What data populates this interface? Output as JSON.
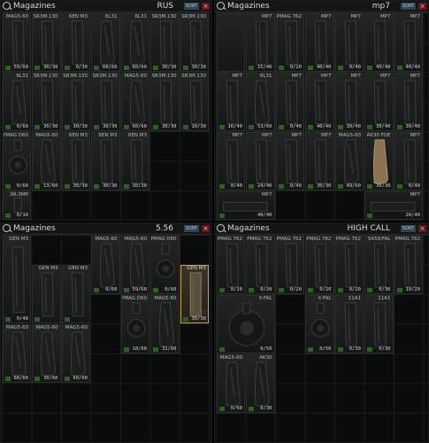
{
  "colors": {
    "accent": "#2e4455",
    "close": "#6a1616",
    "found": "#2f5e28",
    "highlight": "#c9a24a",
    "tan": "#8a7252"
  },
  "panels": [
    {
      "title": "Magazines",
      "filter": "RUS",
      "sort": "SORT",
      "icon_search": "search-icon",
      "close": "×",
      "items": [
        {
          "name": "MAG5-60",
          "count": "59/60"
        },
        {
          "name": "SR3M.130",
          "count": "30/30"
        },
        {
          "name": "6EN M3",
          "count": "0/30"
        },
        {
          "name": "6L31",
          "count": "60/60"
        },
        {
          "name": "6L31",
          "count": "60/60"
        },
        {
          "name": "SR3M.130",
          "count": "30/30"
        },
        {
          "name": "SR3M.130",
          "count": "30/30"
        },
        {
          "name": "6L31",
          "count": "0/60"
        },
        {
          "name": "SR3M.130",
          "count": "30/30"
        },
        {
          "name": "SR3M.130",
          "count": "30/30"
        },
        {
          "name": "SR3M.130",
          "count": "30/30"
        },
        {
          "name": "MAG5-60",
          "count": "60/60"
        },
        {
          "name": "SR3M.130",
          "count": "30/30"
        },
        {
          "name": "SR3M.130",
          "count": "10/30"
        },
        {
          "name": "PMAG D60",
          "count": "0/60"
        },
        {
          "name": "MAG5-60",
          "count": "13/60"
        },
        {
          "name": "6EN M3",
          "count": "30/30"
        },
        {
          "name": "6EN M3",
          "count": "30/30"
        },
        {
          "name": "6EN M3",
          "count": "30/30"
        },
        {
          "name": "SR-3MP",
          "count": "0/10"
        }
      ]
    },
    {
      "title": "Magazines",
      "filter": "mp7",
      "sort": "SORT",
      "icon_search": "search-icon",
      "close": "×",
      "items": [
        {
          "name": "",
          "count": ""
        },
        {
          "name": "MP7",
          "count": "15/40"
        },
        {
          "name": "PMAG 762",
          "count": "0/20"
        },
        {
          "name": "MP7",
          "count": "40/40"
        },
        {
          "name": "MP7",
          "count": "0/40"
        },
        {
          "name": "MP7",
          "count": "40/40"
        },
        {
          "name": "MP7",
          "count": "40/40"
        },
        {
          "name": "MP7",
          "count": "16/40"
        },
        {
          "name": "6L31",
          "count": "53/60"
        },
        {
          "name": "MP7",
          "count": "0/40"
        },
        {
          "name": "MP7",
          "count": "40/40"
        },
        {
          "name": "MP7",
          "count": "30/40"
        },
        {
          "name": "MP7",
          "count": "30/40"
        },
        {
          "name": "MP7",
          "count": "30/40"
        },
        {
          "name": "MP7",
          "count": "0/40"
        },
        {
          "name": "MP7",
          "count": "24/40"
        },
        {
          "name": "MP7",
          "count": "0/40"
        },
        {
          "name": "MP7",
          "count": "30/30"
        },
        {
          "name": "MAG5-60",
          "count": "49/60"
        },
        {
          "name": "AK30 FDE",
          "count": "30/30"
        },
        {
          "name": "MP7",
          "count": "0/40"
        },
        {
          "name": "MP7",
          "count": "40/40"
        },
        {
          "name": "MP7",
          "count": "20/40"
        }
      ]
    },
    {
      "title": "Magazines",
      "filter": "5.56",
      "sort": "SORT",
      "icon_search": "search-icon",
      "close": "×",
      "items": [
        {
          "name": "GEN M3",
          "count": "0/40"
        },
        {
          "name": "MAG5-60",
          "count": "0/60"
        },
        {
          "name": "MAG5-60",
          "count": "59/60"
        },
        {
          "name": "PMAG D60",
          "count": "0/60"
        },
        {
          "name": "GEN M3",
          "count": ""
        },
        {
          "name": "GEN M3",
          "count": ""
        },
        {
          "name": "GEN M3",
          "count": "30/30"
        },
        {
          "name": "PMAG D60",
          "count": "10/60"
        },
        {
          "name": "MAG5-60",
          "count": "31/60"
        },
        {
          "name": "MAG5-60",
          "count": "60/60"
        },
        {
          "name": "MAG5-60",
          "count": "30/60"
        },
        {
          "name": "MAG5-60",
          "count": "60/60"
        }
      ]
    },
    {
      "title": "Magazines",
      "filter": "HIGH CALL",
      "sort": "SORT",
      "icon_search": "search-icon",
      "close": "×",
      "items": [
        {
          "name": "PMAG 762",
          "count": "0/20"
        },
        {
          "name": "PMAG 762",
          "count": "0/20"
        },
        {
          "name": "PMAG 762",
          "count": "0/20"
        },
        {
          "name": "PMAG 762",
          "count": "0/20"
        },
        {
          "name": "PMAG 762",
          "count": "0/20"
        },
        {
          "name": "SA58/FAL",
          "count": "0/30"
        },
        {
          "name": "PMAG 762",
          "count": "19/20"
        },
        {
          "name": "X-FAL",
          "count": "0/50"
        },
        {
          "name": "X-FAL",
          "count": "0/50"
        },
        {
          "name": "11A1",
          "count": "0/30"
        },
        {
          "name": "11A1",
          "count": "0/30"
        },
        {
          "name": "MAG5-60",
          "count": "0/60"
        },
        {
          "name": "AK30",
          "count": "0/30"
        }
      ]
    }
  ]
}
